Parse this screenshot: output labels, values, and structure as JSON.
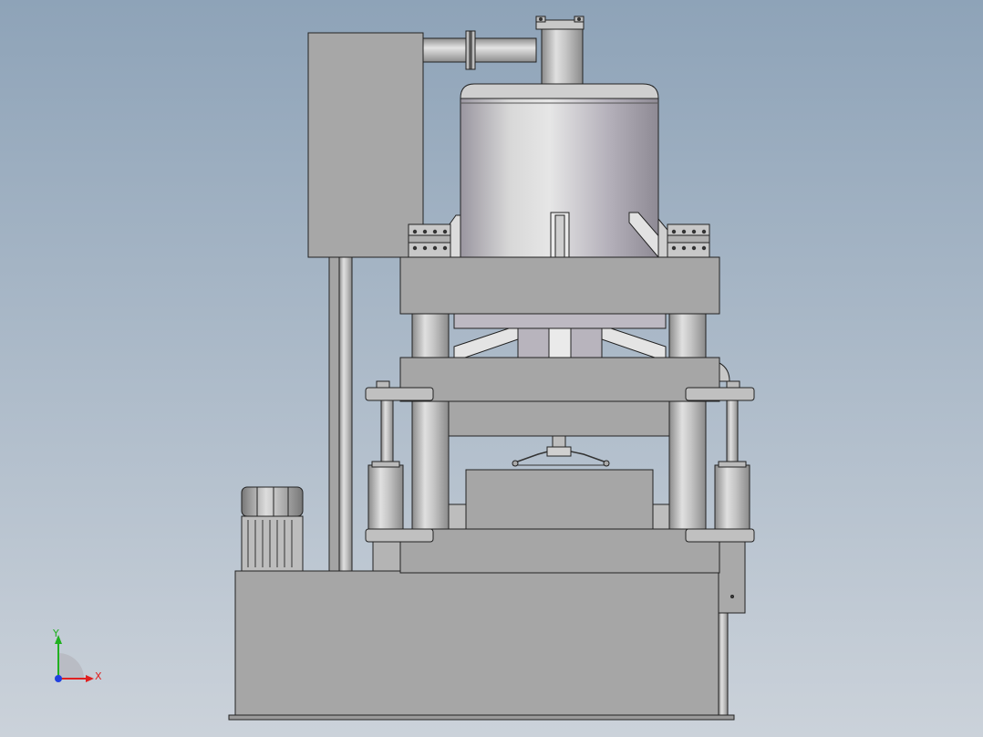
{
  "colors": {
    "background_top": "#8ea3b8",
    "background_bottom": "#c9d0d8",
    "steel": "#a7a7a7",
    "steel_light": "#c4c4c4",
    "steel_dark": "#7d7d7d",
    "outline": "#222222",
    "cylinder_light": "#dcdcdc",
    "cylinder_mid": "#b3afb8",
    "cylinder_dark": "#8e8a94",
    "axis_x": "#e02020",
    "axis_y": "#20b020",
    "axis_z": "#2040e0"
  },
  "triad": {
    "x_label": "X",
    "y_label": "Y"
  }
}
